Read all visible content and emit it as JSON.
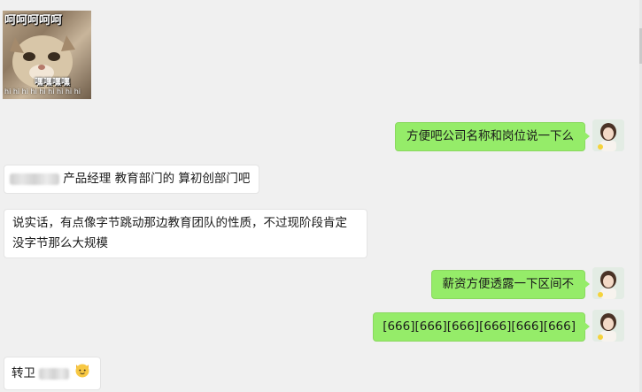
{
  "sticker": {
    "caption_top": "呵呵呵呵呵",
    "caption_mid": "嘿嘿嘿嘿",
    "caption_bottom": "hi hi hi hi hi hi hi hi hi"
  },
  "messages": [
    {
      "side": "out",
      "text": "方便吧公司名称和岗位说一下么"
    },
    {
      "side": "in",
      "text": "产品经理 教育部门的 算初创部门吧"
    },
    {
      "side": "in",
      "text_line1": "说实话，有点像字节跳动那边教育团队的性质，不过现阶段肯定",
      "text_line2": "没字节那么大规模"
    },
    {
      "side": "out",
      "text": "薪资方便透露一下区间不"
    },
    {
      "side": "out",
      "text": "[666][666][666][666][666][666]"
    },
    {
      "side": "in",
      "text": "转卫",
      "emoji": "cat-face"
    }
  ],
  "colors": {
    "background": "#f0f0f0",
    "bubble_out": "#95ec69",
    "bubble_in": "#ffffff"
  }
}
